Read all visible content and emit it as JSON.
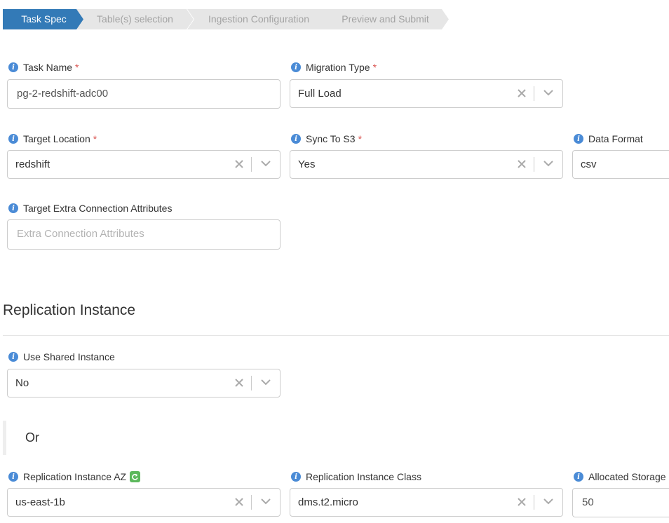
{
  "wizard": {
    "steps": [
      "Task Spec",
      "Table(s) selection",
      "Ingestion Configuration",
      "Preview and Submit"
    ]
  },
  "task_name": {
    "label": "Task Name",
    "required": "*",
    "value": "pg-2-redshift-adc00"
  },
  "migration_type": {
    "label": "Migration Type",
    "required": "*",
    "value": "Full Load"
  },
  "target_location": {
    "label": "Target Location",
    "required": "*",
    "value": "redshift"
  },
  "sync_to_s3": {
    "label": "Sync To S3",
    "required": "*",
    "value": "Yes"
  },
  "data_format": {
    "label": "Data Format",
    "value": "csv"
  },
  "target_extra": {
    "label": "Target Extra Connection Attributes",
    "placeholder": "Extra Connection Attributes"
  },
  "replication_section": {
    "title": "Replication Instance"
  },
  "use_shared_instance": {
    "label": "Use Shared Instance",
    "value": "No"
  },
  "or_text": "Or",
  "replication_az": {
    "label": "Replication Instance AZ",
    "value": "us-east-1b"
  },
  "replication_class": {
    "label": "Replication Instance Class",
    "value": "dms.t2.micro"
  },
  "allocated_storage": {
    "label": "Allocated Storage",
    "value": "50"
  },
  "colors": {
    "primary": "#337ab7",
    "step_inactive": "#e6e6e6",
    "required": "#d9534f",
    "info_icon": "#4a8bd6",
    "refresh_icon": "#5cb85c"
  },
  "icons": [
    "info-icon",
    "clear-icon",
    "chevron-down-icon",
    "refresh-icon"
  ]
}
